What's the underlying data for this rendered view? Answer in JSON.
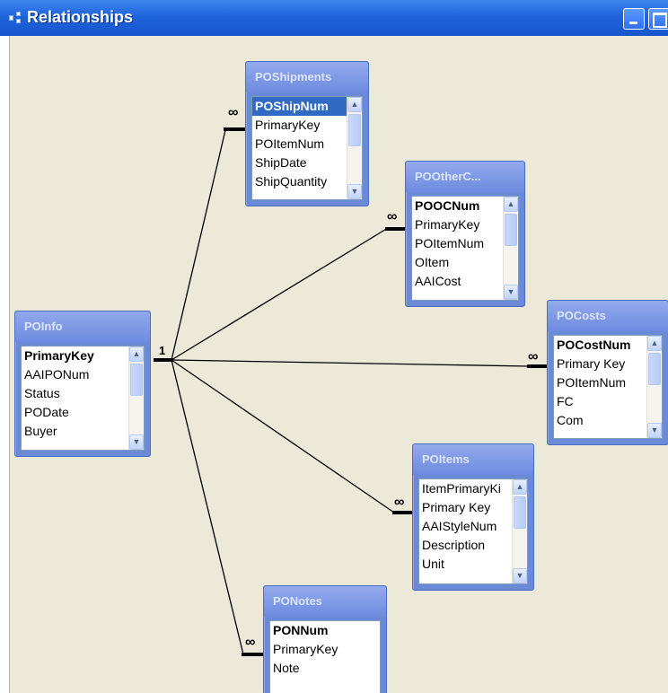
{
  "window": {
    "title": "Relationships",
    "icon": "relationships-icon"
  },
  "tables": {
    "poinfo": {
      "title": "POInfo",
      "fields": [
        "PrimaryKey",
        "AAIPONum",
        "Status",
        "PODate",
        "Buyer"
      ]
    },
    "poshipments": {
      "title": "POShipments",
      "fields": [
        "POShipNum",
        "PrimaryKey",
        "POItemNum",
        "ShipDate",
        "ShipQuantity"
      ]
    },
    "poother": {
      "title": "POOtherC...",
      "fields": [
        "POOCNum",
        "PrimaryKey",
        "POItemNum",
        "OItem",
        "AAICost"
      ]
    },
    "pocosts": {
      "title": "POCosts",
      "fields": [
        "POCostNum",
        "Primary Key",
        "POItemNum",
        "FC",
        "Com"
      ]
    },
    "poitems": {
      "title": "POItems",
      "fields": [
        "ItemPrimaryKi",
        "Primary Key",
        "AAIStyleNum",
        "Description",
        "Unit"
      ]
    },
    "ponotes": {
      "title": "PONotes",
      "fields": [
        "PONNum",
        "PrimaryKey",
        "Note"
      ]
    }
  },
  "relationship": {
    "one_label": "1",
    "many_label": "∞"
  },
  "colors": {
    "titlebar": "#1f64dc",
    "canvas": "#ece9d8",
    "table_frame": "#6a8ad8",
    "selection": "#316ac5"
  }
}
